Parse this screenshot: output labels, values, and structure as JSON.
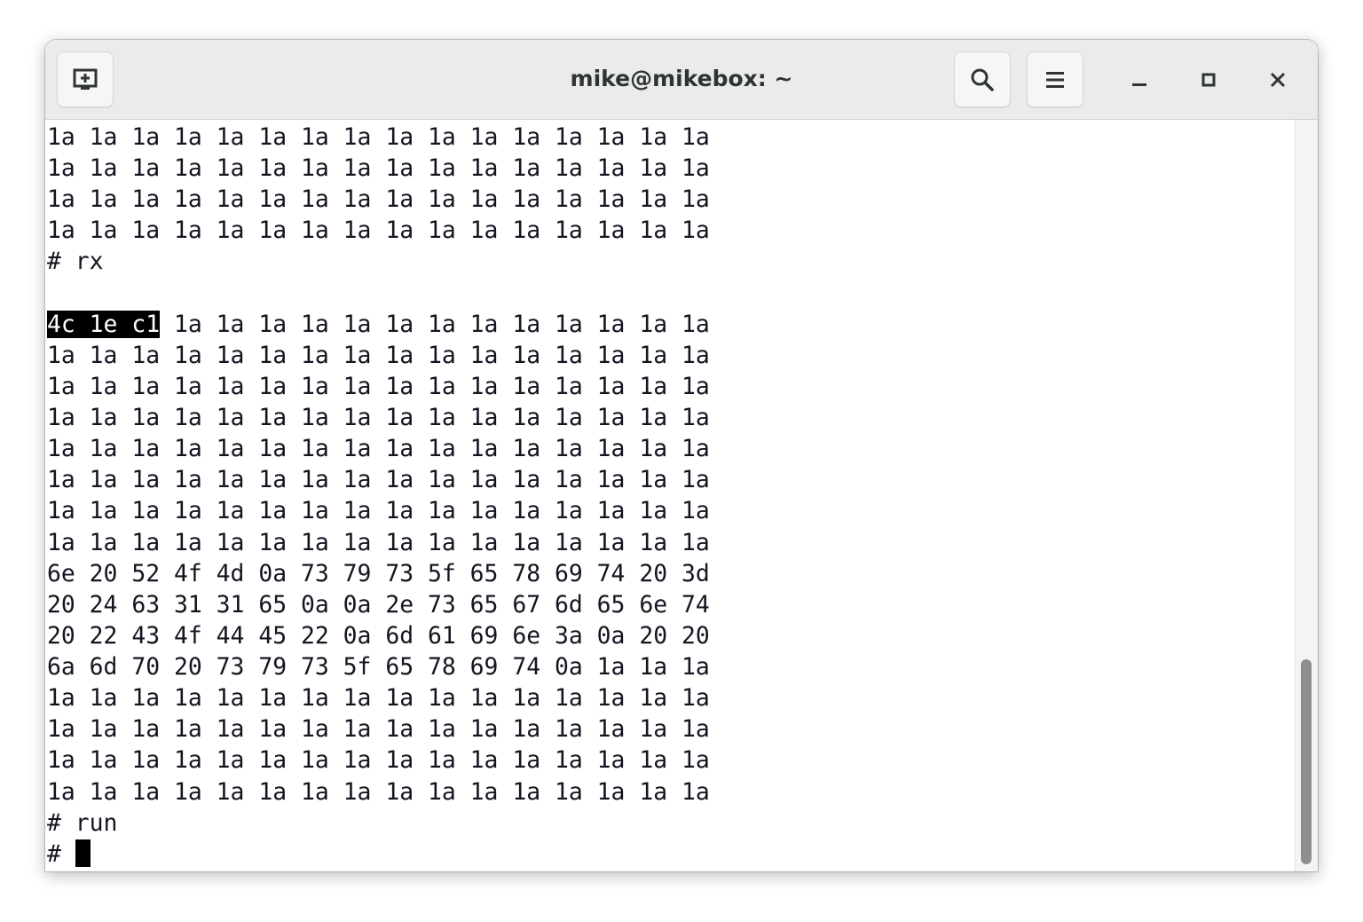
{
  "window": {
    "title": "mike@mikebox: ~"
  },
  "titlebar": {
    "new_tab_icon": "new-tab-icon",
    "search_icon": "search-icon",
    "menu_icon": "hamburger-menu-icon",
    "minimize_icon": "minimize-icon",
    "maximize_icon": "maximize-icon",
    "close_icon": "close-icon"
  },
  "terminal": {
    "lines": [
      {
        "sel": "",
        "text": "1a 1a 1a 1a 1a 1a 1a 1a 1a 1a 1a 1a 1a 1a 1a 1a"
      },
      {
        "sel": "",
        "text": "1a 1a 1a 1a 1a 1a 1a 1a 1a 1a 1a 1a 1a 1a 1a 1a"
      },
      {
        "sel": "",
        "text": "1a 1a 1a 1a 1a 1a 1a 1a 1a 1a 1a 1a 1a 1a 1a 1a"
      },
      {
        "sel": "",
        "text": "1a 1a 1a 1a 1a 1a 1a 1a 1a 1a 1a 1a 1a 1a 1a 1a"
      },
      {
        "sel": "",
        "text": "# rx"
      },
      {
        "sel": "",
        "text": ""
      },
      {
        "sel": "4c 1e c1",
        "text": " 1a 1a 1a 1a 1a 1a 1a 1a 1a 1a 1a 1a 1a"
      },
      {
        "sel": "",
        "text": "1a 1a 1a 1a 1a 1a 1a 1a 1a 1a 1a 1a 1a 1a 1a 1a"
      },
      {
        "sel": "",
        "text": "1a 1a 1a 1a 1a 1a 1a 1a 1a 1a 1a 1a 1a 1a 1a 1a"
      },
      {
        "sel": "",
        "text": "1a 1a 1a 1a 1a 1a 1a 1a 1a 1a 1a 1a 1a 1a 1a 1a"
      },
      {
        "sel": "",
        "text": "1a 1a 1a 1a 1a 1a 1a 1a 1a 1a 1a 1a 1a 1a 1a 1a"
      },
      {
        "sel": "",
        "text": "1a 1a 1a 1a 1a 1a 1a 1a 1a 1a 1a 1a 1a 1a 1a 1a"
      },
      {
        "sel": "",
        "text": "1a 1a 1a 1a 1a 1a 1a 1a 1a 1a 1a 1a 1a 1a 1a 1a"
      },
      {
        "sel": "",
        "text": "1a 1a 1a 1a 1a 1a 1a 1a 1a 1a 1a 1a 1a 1a 1a 1a"
      },
      {
        "sel": "",
        "text": "6e 20 52 4f 4d 0a 73 79 73 5f 65 78 69 74 20 3d"
      },
      {
        "sel": "",
        "text": "20 24 63 31 31 65 0a 0a 2e 73 65 67 6d 65 6e 74"
      },
      {
        "sel": "",
        "text": "20 22 43 4f 44 45 22 0a 6d 61 69 6e 3a 0a 20 20"
      },
      {
        "sel": "",
        "text": "6a 6d 70 20 73 79 73 5f 65 78 69 74 0a 1a 1a 1a"
      },
      {
        "sel": "",
        "text": "1a 1a 1a 1a 1a 1a 1a 1a 1a 1a 1a 1a 1a 1a 1a 1a"
      },
      {
        "sel": "",
        "text": "1a 1a 1a 1a 1a 1a 1a 1a 1a 1a 1a 1a 1a 1a 1a 1a"
      },
      {
        "sel": "",
        "text": "1a 1a 1a 1a 1a 1a 1a 1a 1a 1a 1a 1a 1a 1a 1a 1a"
      },
      {
        "sel": "",
        "text": "1a 1a 1a 1a 1a 1a 1a 1a 1a 1a 1a 1a 1a 1a 1a 1a"
      },
      {
        "sel": "",
        "text": "# run"
      }
    ],
    "prompt": "# ",
    "scroll_position": 0.72
  }
}
